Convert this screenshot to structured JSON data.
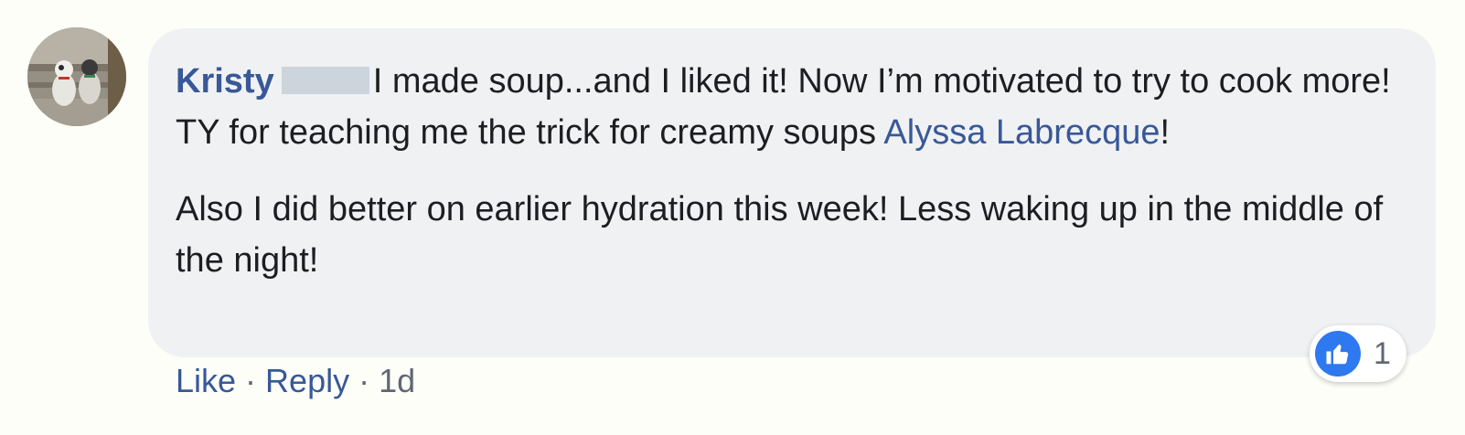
{
  "comment": {
    "author": "Kristy",
    "text_line1": "I made soup...and I liked it! Now I’m motivated to try to cook more! TY for teaching me the trick for creamy soups ",
    "mention": "Alyssa Labrecque",
    "text_line1_end": "!",
    "text_line2": "Also I did better on earlier hydration this week! Less waking up in the middle of the night!"
  },
  "actions": {
    "like_label": "Like",
    "reply_label": "Reply",
    "separator": "·",
    "timestamp": "1d"
  },
  "reactions": {
    "icon": "thumbs-up-icon",
    "count": "1"
  },
  "colors": {
    "link": "#385898",
    "bubble": "#f0f1f3",
    "like_blue": "#2e78f0"
  }
}
